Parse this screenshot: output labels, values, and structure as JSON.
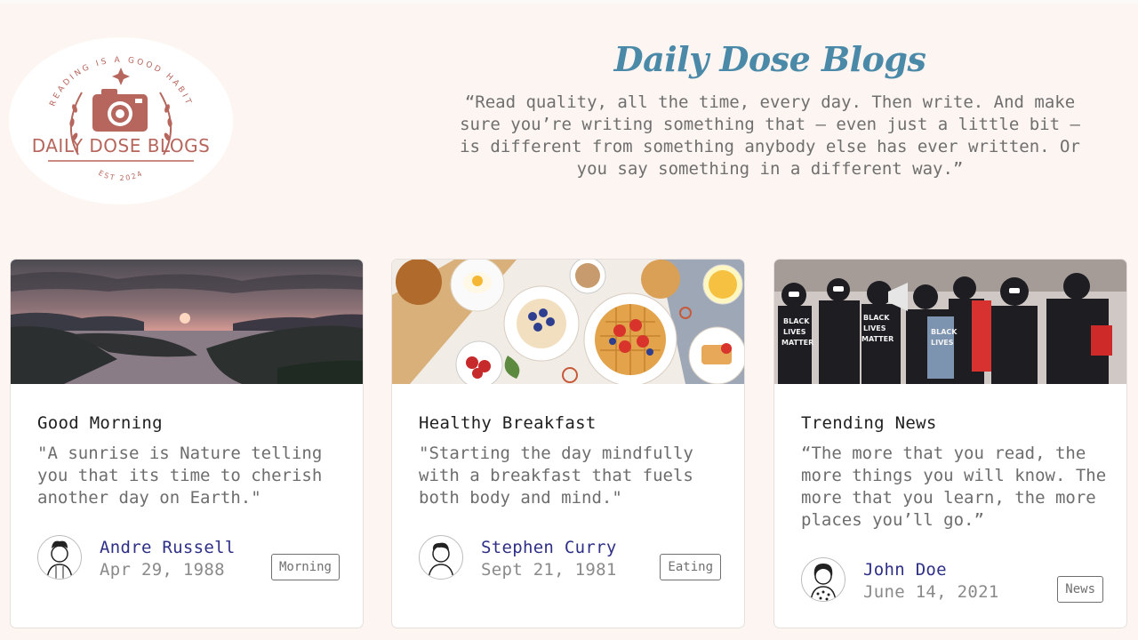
{
  "logo": {
    "name": "DAILY DOSE BLOGS",
    "tagline_top": "READING IS A GOOD HABIT",
    "est": "EST 2024",
    "icon": "camera-icon"
  },
  "header": {
    "title": "Daily Dose Blogs",
    "quote": "“Read quality, all the time, every day. Then write. And make sure you’re writing something that – even just a little bit – is different from something anybody else has ever written. Or you say something in a different way.”"
  },
  "cards": [
    {
      "title": "Good Morning",
      "text": "\"A sunrise is Nature telling you that its time to cherish another day on Earth.\"",
      "author": "Andre Russell",
      "date": "Apr 29, 1988",
      "tag": "Morning"
    },
    {
      "title": "Healthy Breakfast",
      "text": "\"Starting the day mindfully with a breakfast that fuels both body and mind.\"",
      "author": "Stephen Curry",
      "date": "Sept 21, 1981",
      "tag": "Eating"
    },
    {
      "title": "Trending News",
      "text": "“The more that you read, the more things you will know. The more that you learn, the more places you’ll go.”",
      "author": "John Doe",
      "date": "June 14, 2021",
      "tag": "News"
    }
  ],
  "colors": {
    "background": "#fdf5f1",
    "title": "#4a8aa8",
    "author_name": "#2e2f86",
    "logo": "#b6665c"
  }
}
